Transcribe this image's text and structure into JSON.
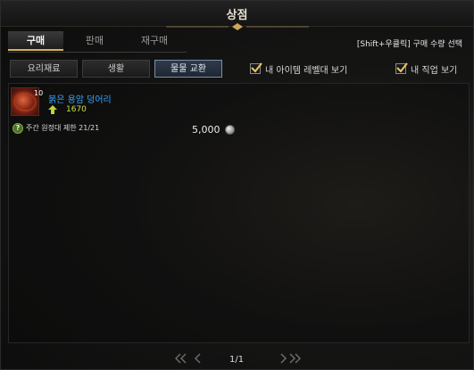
{
  "window": {
    "title": "상점"
  },
  "tabs": [
    {
      "label": "구매",
      "active": true
    },
    {
      "label": "판매",
      "active": false
    },
    {
      "label": "재구매",
      "active": false
    }
  ],
  "shift_hint": "[Shift+우클릭] 구매 수량 선택",
  "categories": [
    {
      "label": "요리재료",
      "active": false
    },
    {
      "label": "생활",
      "active": false
    },
    {
      "label": "물물 교환",
      "active": true
    }
  ],
  "filters": [
    {
      "label": "내 아이템 레벨대 보기",
      "checked": true
    },
    {
      "label": "내 직업 보기",
      "checked": true
    }
  ],
  "items": [
    {
      "quantity": "10",
      "name": "붉은 용암 덩어리",
      "item_level": "1670",
      "limit": "주간 원정대 제한 21/21",
      "price": "5,000",
      "currency_icon": "silver-coin-icon"
    }
  ],
  "pagination": {
    "page": "1/1"
  },
  "colors": {
    "item_name": "#36a7ff",
    "item_level": "#c9e04a",
    "tab_accent": "#d6b25a"
  }
}
